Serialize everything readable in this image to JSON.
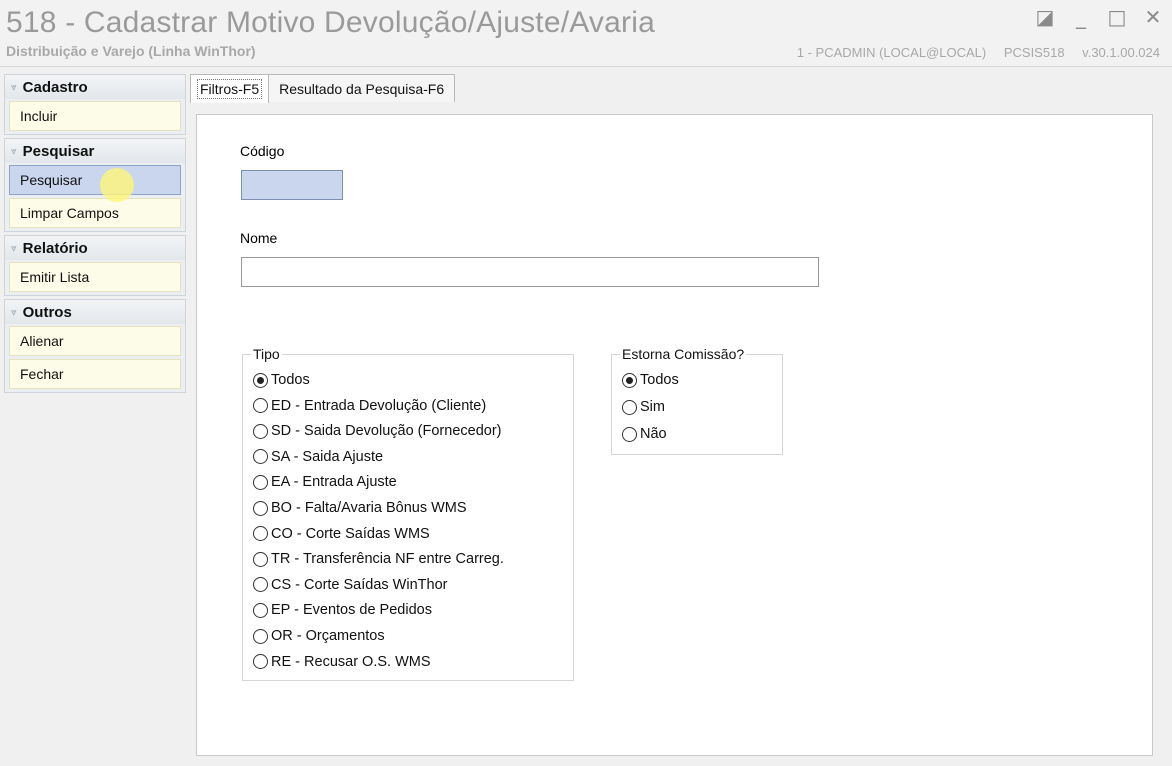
{
  "window": {
    "title": "518 - Cadastrar Motivo Devolução/Ajuste/Avaria",
    "subtitle": "Distribuição e Varejo (Linha WinThor)",
    "user": "1 - PCADMIN (LOCAL@LOCAL)",
    "program": "PCSIS518",
    "version": "v.30.1.00.024",
    "controls": {
      "restore": "◪",
      "minimize": "_",
      "maximize": "□",
      "close": "✕"
    }
  },
  "sidebar": {
    "groups": [
      {
        "title": "Cadastro",
        "items": [
          "Incluir"
        ]
      },
      {
        "title": "Pesquisar",
        "items": [
          "Pesquisar",
          "Limpar Campos"
        ]
      },
      {
        "title": "Relatório",
        "items": [
          "Emitir Lista"
        ]
      },
      {
        "title": "Outros",
        "items": [
          "Alienar",
          "Fechar"
        ]
      }
    ],
    "chevron": "⩔",
    "active_item": "Pesquisar"
  },
  "tabs": [
    {
      "label": "Filtros-F5",
      "active": true
    },
    {
      "label": "Resultado da Pesquisa-F6",
      "active": false
    }
  ],
  "form": {
    "codigo_label": "Código",
    "codigo_value": "",
    "nome_label": "Nome",
    "nome_value": "",
    "tipo": {
      "legend": "Tipo",
      "selected": "Todos",
      "options": [
        "Todos",
        "ED - Entrada Devolução (Cliente)",
        "SD - Saida Devolução (Fornecedor)",
        "SA - Saida Ajuste",
        "EA - Entrada Ajuste",
        "BO - Falta/Avaria Bônus WMS",
        "CO - Corte Saídas WMS",
        "TR - Transferência NF entre Carreg.",
        "CS - Corte Saídas WinThor",
        "EP - Eventos de Pedidos",
        "OR - Orçamentos",
        "RE - Recusar O.S. WMS"
      ]
    },
    "estorna": {
      "legend": "Estorna Comissão?",
      "selected": "Todos",
      "options": [
        "Todos",
        "Sim",
        "Não"
      ]
    }
  }
}
